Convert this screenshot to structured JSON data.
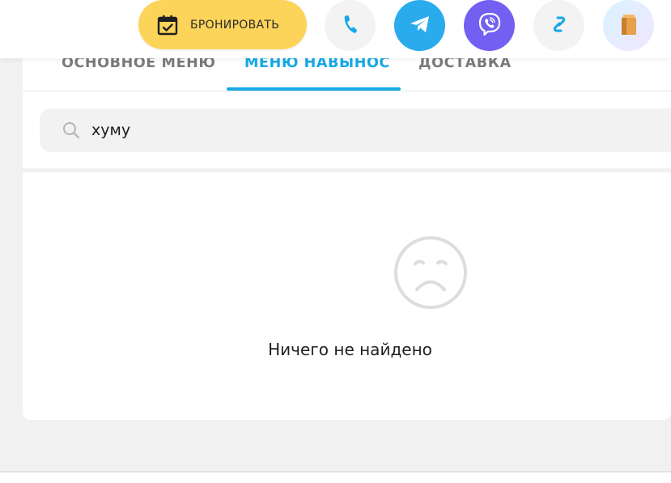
{
  "header": {
    "book_button_label": "БРОНИРОВАТЬ",
    "contacts": [
      {
        "name": "phone",
        "icon": "phone-icon",
        "bg": "#f3f3f3",
        "color": "#14a8e6"
      },
      {
        "name": "telegram",
        "icon": "telegram-icon",
        "bg": "#2aabee",
        "color": "#ffffff"
      },
      {
        "name": "viber",
        "icon": "viber-icon",
        "bg": "#7360f2",
        "color": "#ffffff"
      },
      {
        "name": "link",
        "icon": "link-icon",
        "bg": "#f3f3f3",
        "color": "#14a8e6"
      },
      {
        "name": "bag",
        "icon": "paper-bag-icon",
        "bg": "#eef3ff",
        "color": "#e8a04a"
      }
    ]
  },
  "tabs": [
    {
      "label": "ОСНОВНОЕ МЕНЮ",
      "active": false
    },
    {
      "label": "МЕНЮ НАВЫНОС",
      "active": true
    },
    {
      "label": "ДОСТАВКА",
      "active": false
    }
  ],
  "search": {
    "value": "хуму",
    "placeholder": ""
  },
  "empty_state": {
    "icon": "sad-face-icon",
    "message": "Ничего не найдено"
  },
  "colors": {
    "accent": "#14a8e6",
    "book_button": "#fcd45a",
    "background": "#f1f1f1"
  }
}
